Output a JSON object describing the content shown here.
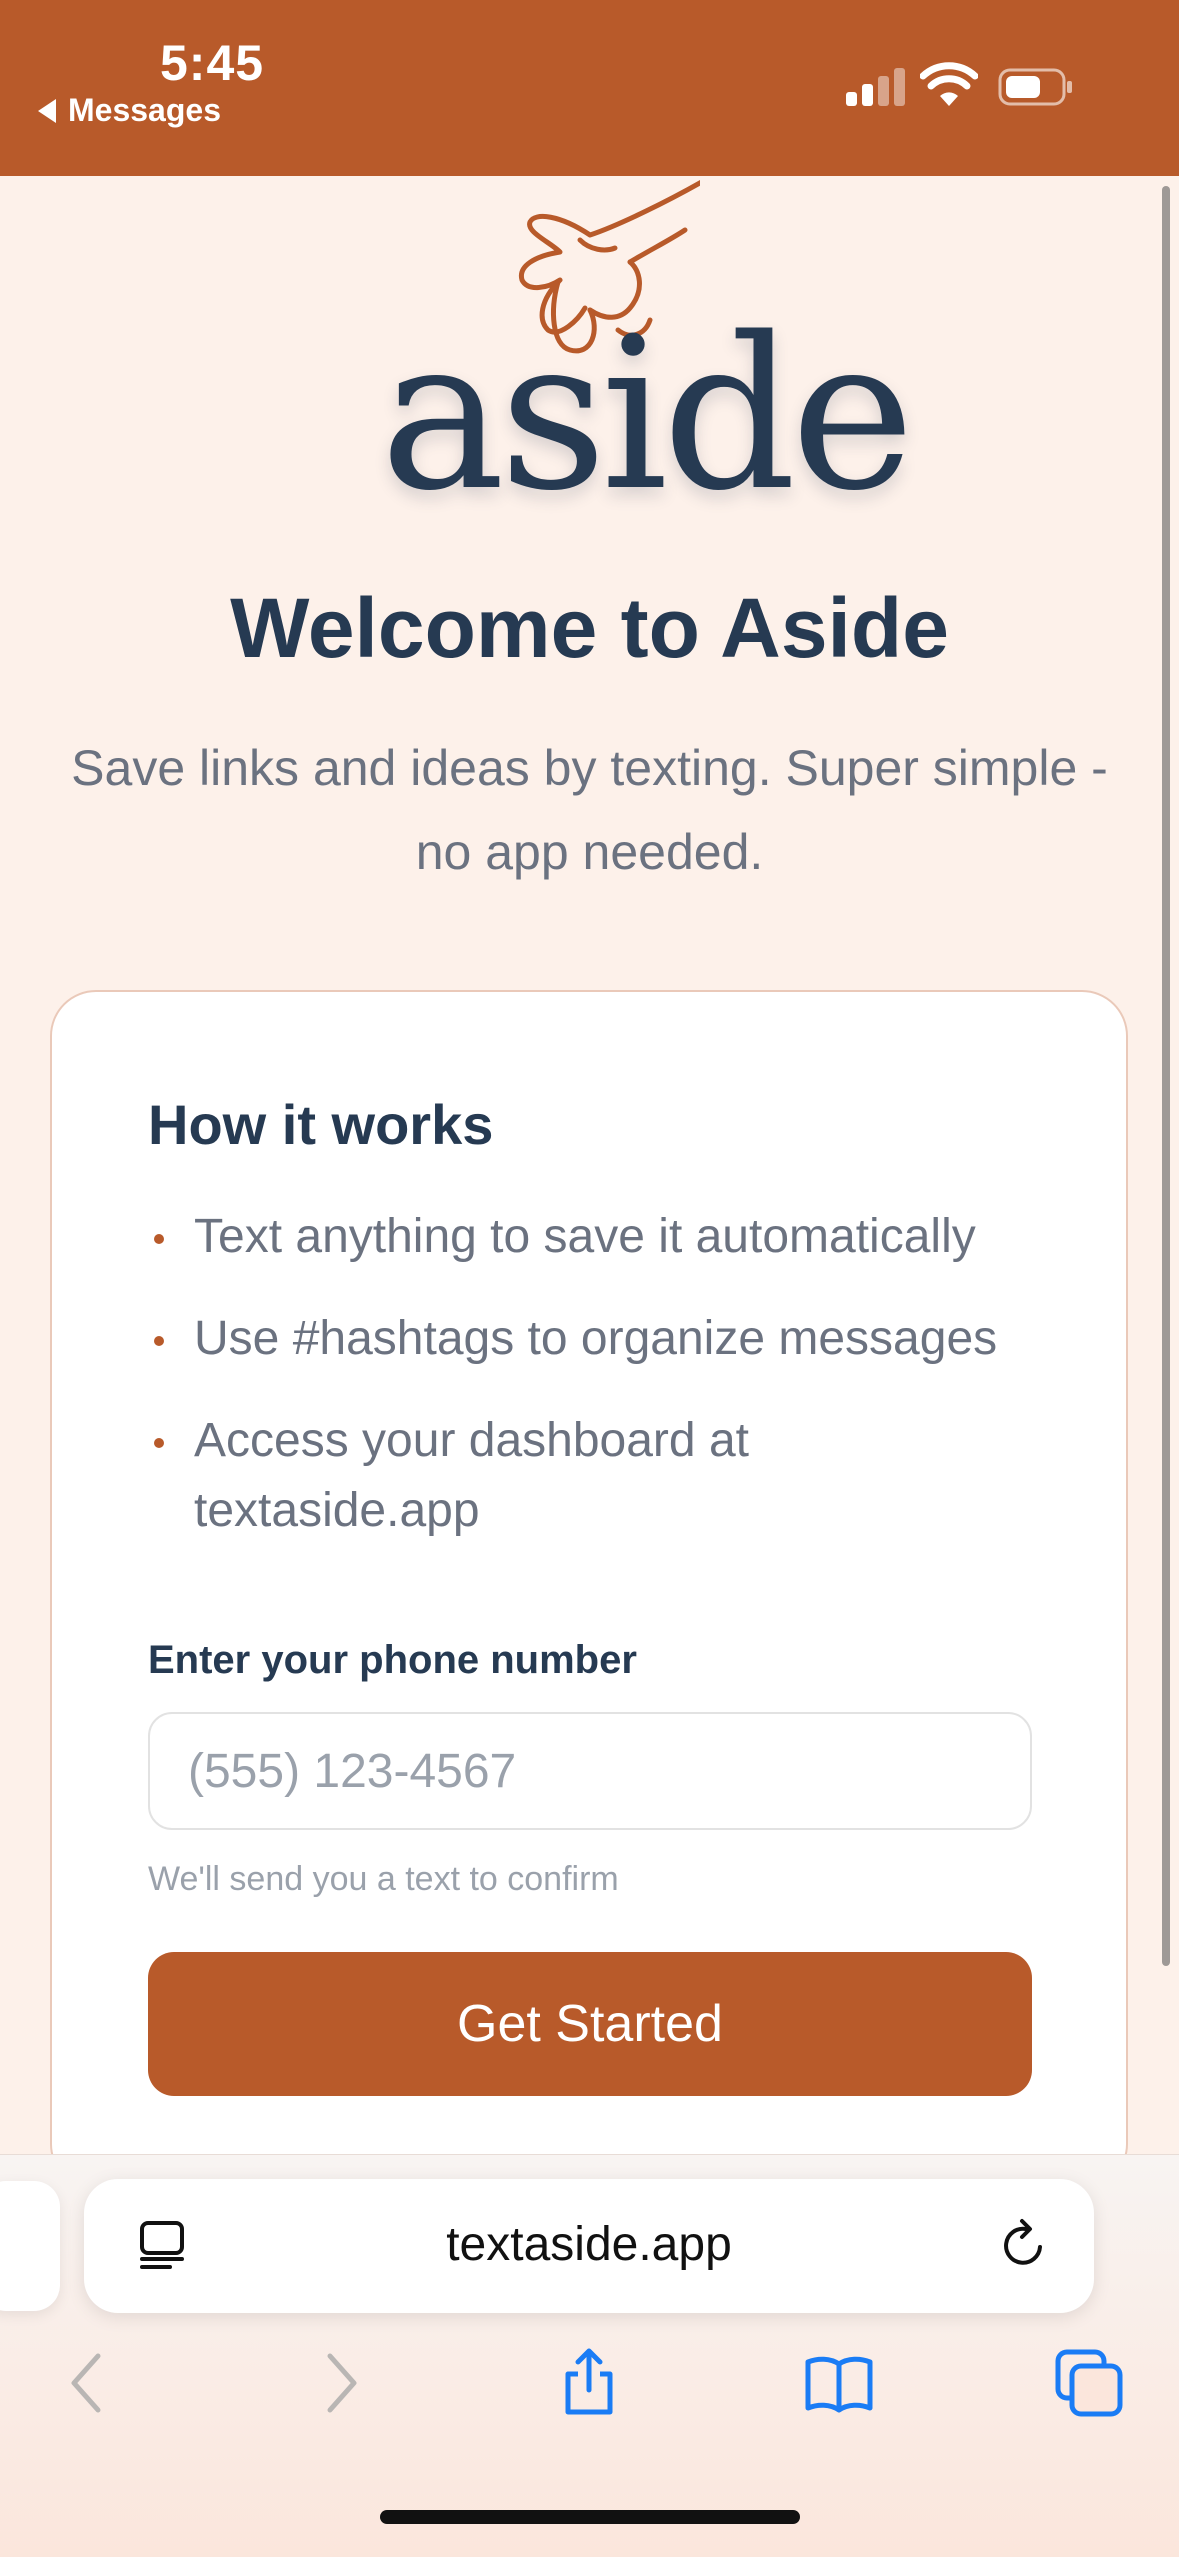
{
  "status_bar": {
    "time": "5:45",
    "back_label": "Messages",
    "background_color": "#b85a2a"
  },
  "logo": {
    "wordmark": "aside",
    "icon": "hand-drawn-hand-icon"
  },
  "hero": {
    "title": "Welcome to Aside",
    "subtitle": "Save links and ideas by texting. Super simple - no app needed."
  },
  "card": {
    "title": "How it works",
    "steps": [
      "Text anything to save it automatically",
      "Use #hashtags to organize messages",
      "Access your dashboard at textaside.app"
    ],
    "phone_label": "Enter your phone number",
    "phone_placeholder": "(555) 123-4567",
    "phone_value": "",
    "helper_text": "We'll send you a text to confirm",
    "cta_label": "Get Started"
  },
  "browser": {
    "url": "textaside.app",
    "icons": [
      "reader-icon",
      "reload-icon",
      "back-icon",
      "forward-icon",
      "share-icon",
      "bookmarks-icon",
      "tabs-icon"
    ]
  },
  "colors": {
    "accent": "#b85a2a",
    "heading": "#263a52",
    "body_text": "#6b7280",
    "page_background": "#fdf1ea",
    "ios_blue": "#1a7cf5"
  }
}
